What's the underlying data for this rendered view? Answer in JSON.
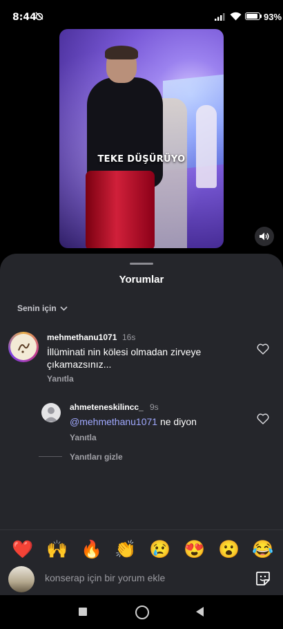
{
  "status_bar": {
    "time": "8:44",
    "battery_percent": "93",
    "battery_level": 0.93,
    "signal_icon": "signal-icon",
    "wifi_icon": "wifi-icon"
  },
  "video": {
    "caption": "TEKE DÜŞÜRÜYO"
  },
  "comments_sheet": {
    "title": "Yorumlar",
    "sort_label": "Senin için",
    "comments": [
      {
        "username": "mehmethanu1071",
        "time": "16s",
        "text": "İllüminati nin kölesi olmadan zirveye çıkamazsınız...",
        "reply_label": "Yanıtla"
      }
    ],
    "replies": [
      {
        "username": "ahmeteneskilincc_",
        "time": "9s",
        "mention": "@mehmethanu1071",
        "text": " ne diyon",
        "reply_label": "Yanıtla"
      }
    ],
    "hide_replies_label": "Yanıtları gizle"
  },
  "emoji_bar": [
    "❤️",
    "🙌",
    "🔥",
    "👏",
    "😢",
    "😍",
    "😮",
    "😂"
  ],
  "comment_input": {
    "placeholder": "konserap için bir yorum ekle"
  },
  "colors": {
    "sheet_bg": "#25262b",
    "mention": "#a0a9ff",
    "heart": "#e0283c"
  }
}
